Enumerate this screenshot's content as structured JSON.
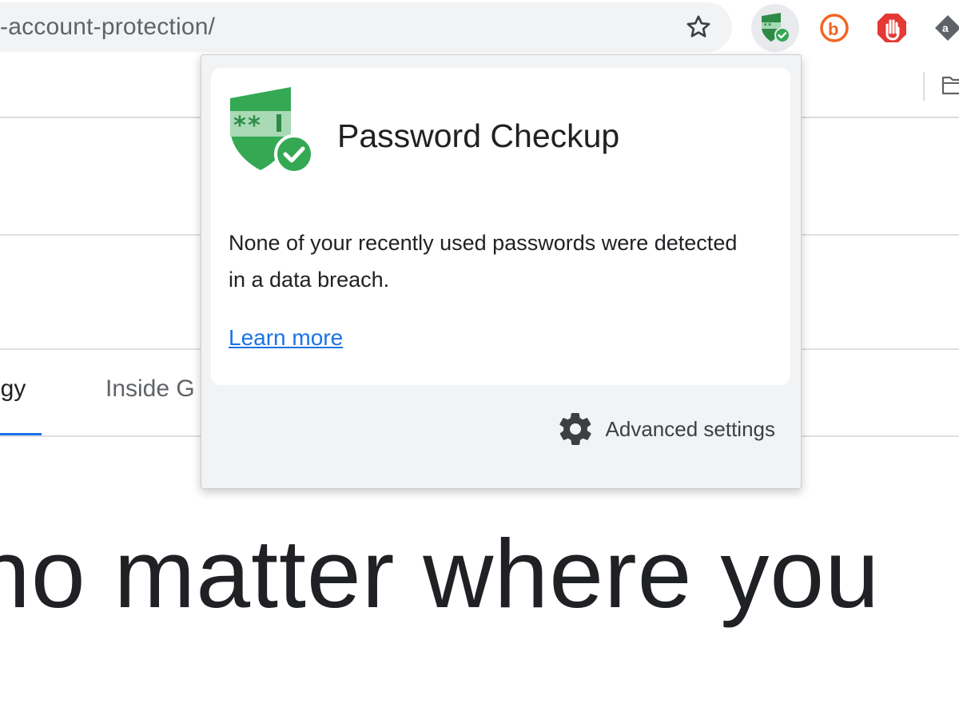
{
  "browser": {
    "url_fragment": "-account-protection/",
    "extensions": [
      {
        "name": "password-checkup",
        "icon": "password-checkup-icon",
        "active": true
      },
      {
        "name": "b-extension",
        "icon": "b-circle-icon"
      },
      {
        "name": "adblock",
        "icon": "hand-stop-icon"
      },
      {
        "name": "amazon-assistant",
        "icon": "amazon-icon"
      }
    ]
  },
  "page": {
    "nav_tabs": [
      "ogy",
      "Inside G"
    ],
    "headline": "no matter where you"
  },
  "popup": {
    "title": "Password Checkup",
    "message": "None of your recently used passwords were detected in a data breach.",
    "link_label": "Learn more",
    "footer_label": "Advanced settings"
  },
  "colors": {
    "accent": "#1a73e8",
    "shield_green": "#34a853",
    "shield_dark": "#2e8b45",
    "popup_bg": "#f1f3f4",
    "b_orange": "#f26522",
    "hand_red": "#e53935"
  }
}
